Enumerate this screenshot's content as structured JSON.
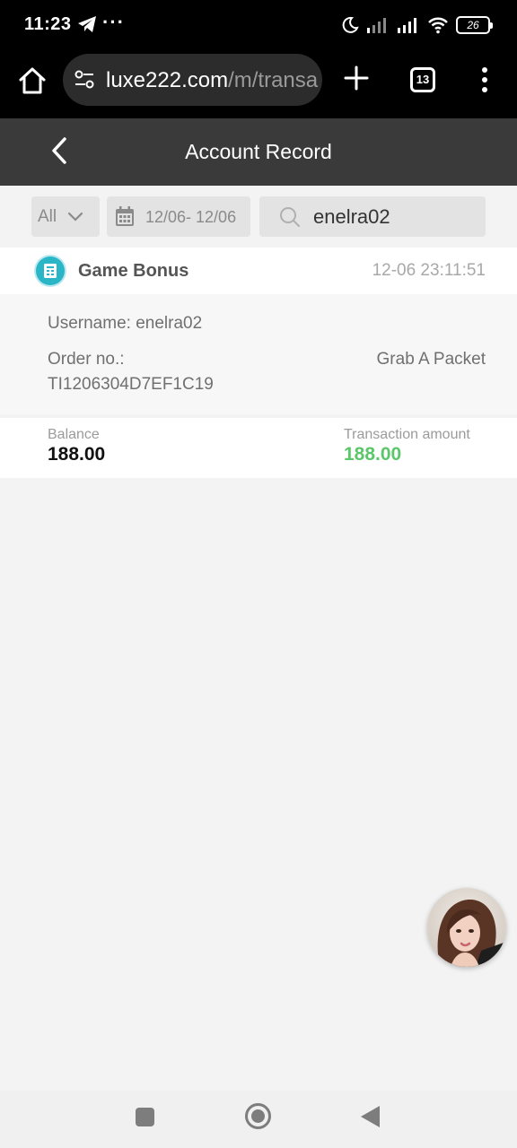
{
  "status_bar": {
    "time": "11:23",
    "more": "···",
    "battery": "26"
  },
  "browser": {
    "url_host": "luxe222.com",
    "url_path": "/m/transa",
    "tab_count": "13"
  },
  "header": {
    "title": "Account Record"
  },
  "filters": {
    "type_value": "All",
    "date_range": "12/06- 12/06",
    "search_value": "enelra02"
  },
  "record": {
    "type": "Game Bonus",
    "datetime": "12-06 23:11:51",
    "username_line": "Username: enelra02",
    "order_label": "Order no.:",
    "order_number": "TI1206304D7EF1C19",
    "description": "Grab A Packet",
    "balance_label": "Balance",
    "balance_value": "188.00",
    "amount_label": "Transaction amount",
    "amount_value": "188.00"
  },
  "colors": {
    "header_bg": "#3a3a3a",
    "accent_icon": "#2bb6c8",
    "amount_positive": "#5cc76a"
  },
  "icons": {
    "home": "home-icon",
    "site_settings": "tune-icon",
    "new_tab": "plus-icon",
    "menu": "more-vert-icon",
    "back": "chevron-left-icon",
    "dropdown": "chevron-down-icon",
    "calendar": "calendar-icon",
    "search": "search-icon",
    "record_type": "receipt-icon"
  }
}
